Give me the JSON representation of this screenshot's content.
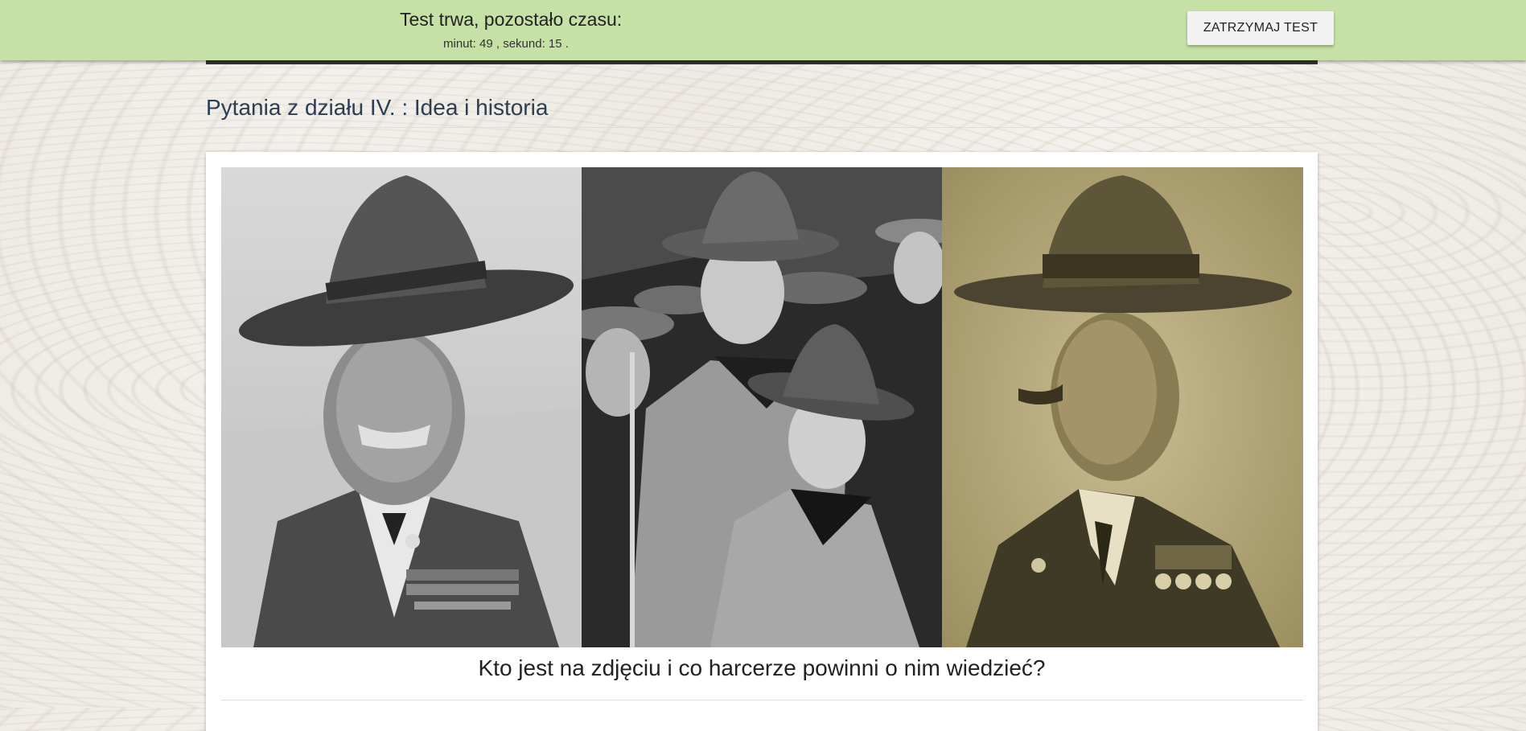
{
  "timer": {
    "title": "Test trwa, pozostało czasu:",
    "remaining": "minut: 49 , sekund: 15 .",
    "stop_label": "ZATRZYMAJ TEST"
  },
  "section": {
    "title": "Pytania z działu IV. : Idea i historia"
  },
  "question": {
    "text": "Kto jest na zdjęciu i co harcerze powinni o nim wiedzieć?"
  },
  "colors": {
    "topbar": "#c5e1a5",
    "section_title": "#2c3e50"
  }
}
